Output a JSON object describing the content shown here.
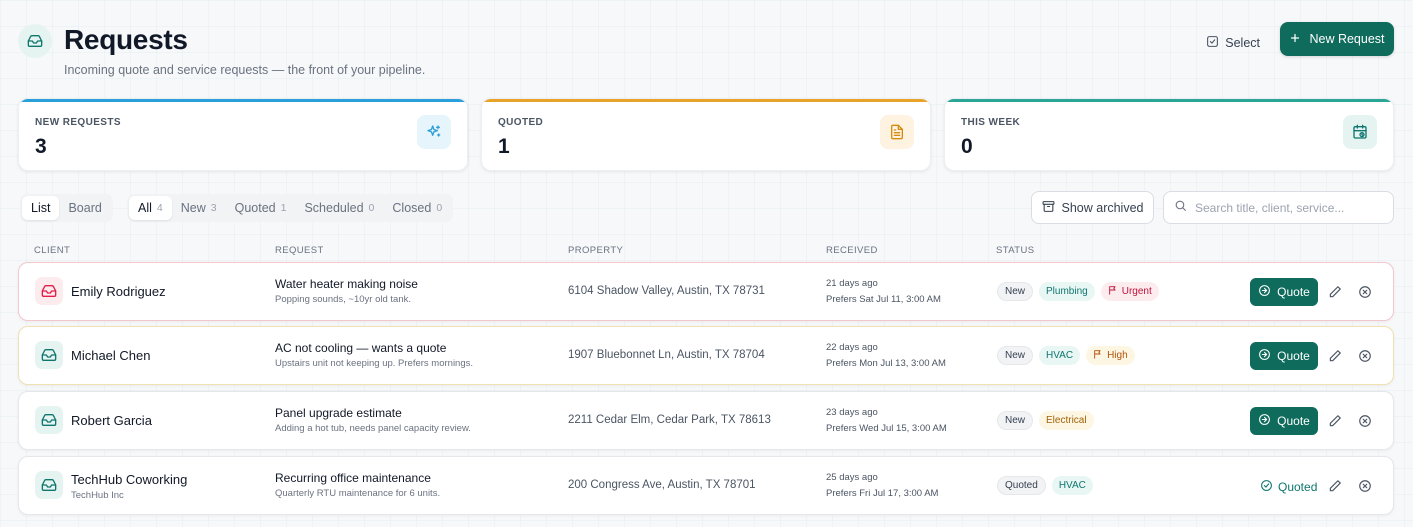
{
  "header": {
    "title": "Requests",
    "subtitle": "Incoming quote and service requests — the front of your pipeline.",
    "select_label": "Select",
    "new_request_label": "New Request"
  },
  "stats": [
    {
      "label": "NEW REQUESTS",
      "value": "3",
      "color": "#2b9fd9",
      "icon": "sparkles-icon"
    },
    {
      "label": "QUOTED",
      "value": "1",
      "color": "#e8a42a",
      "icon": "document-icon"
    },
    {
      "label": "THIS WEEK",
      "value": "0",
      "color": "#2aa596",
      "icon": "calendar-icon"
    }
  ],
  "view_toggle": {
    "list": "List",
    "board": "Board",
    "selected": "List"
  },
  "filters": [
    {
      "label": "All",
      "count": "4"
    },
    {
      "label": "New",
      "count": "3"
    },
    {
      "label": "Quoted",
      "count": "1"
    },
    {
      "label": "Scheduled",
      "count": "0"
    },
    {
      "label": "Closed",
      "count": "0"
    }
  ],
  "selected_filter": "All",
  "show_archived_label": "Show archived",
  "search": {
    "placeholder": "Search title, client, service...",
    "value": ""
  },
  "columns": {
    "client": "CLIENT",
    "request": "REQUEST",
    "property": "PROPERTY",
    "received": "RECEIVED",
    "status": "STATUS"
  },
  "rows": [
    {
      "client": "Emily Rodriguez",
      "company": "",
      "title": "Water heater making noise",
      "subtitle": "Popping sounds, ~10yr old tank.",
      "property": "6104 Shadow Valley, Austin, TX 78731",
      "received": "21 days ago",
      "prefers": "Prefers Sat Jul 11, 3:00 AM",
      "status": "New",
      "service": "Plumbing",
      "priority": "Urgent",
      "action": "Quote",
      "accent": "#e11d48"
    },
    {
      "client": "Michael Chen",
      "company": "",
      "title": "AC not cooling — wants a quote",
      "subtitle": "Upstairs unit not keeping up. Prefers mornings.",
      "property": "1907 Bluebonnet Ln, Austin, TX 78704",
      "received": "22 days ago",
      "prefers": "Prefers Mon Jul 13, 3:00 AM",
      "status": "New",
      "service": "HVAC",
      "priority": "High",
      "action": "Quote",
      "accent": "#0f766e"
    },
    {
      "client": "Robert Garcia",
      "company": "",
      "title": "Panel upgrade estimate",
      "subtitle": "Adding a hot tub, needs panel capacity review.",
      "property": "2211 Cedar Elm, Cedar Park, TX 78613",
      "received": "23 days ago",
      "prefers": "Prefers Wed Jul 15, 3:00 AM",
      "status": "New",
      "service": "Electrical",
      "priority": "",
      "action": "Quote",
      "accent": "#0f766e"
    },
    {
      "client": "TechHub Coworking",
      "company": "TechHub Inc",
      "title": "Recurring office maintenance",
      "subtitle": "Quarterly RTU maintenance for 6 units.",
      "property": "200 Congress Ave, Austin, TX 78701",
      "received": "25 days ago",
      "prefers": "Prefers Fri Jul 17, 3:00 AM",
      "status": "Quoted",
      "service": "HVAC",
      "priority": "",
      "action": "Quoted",
      "accent": "#0f766e"
    }
  ]
}
